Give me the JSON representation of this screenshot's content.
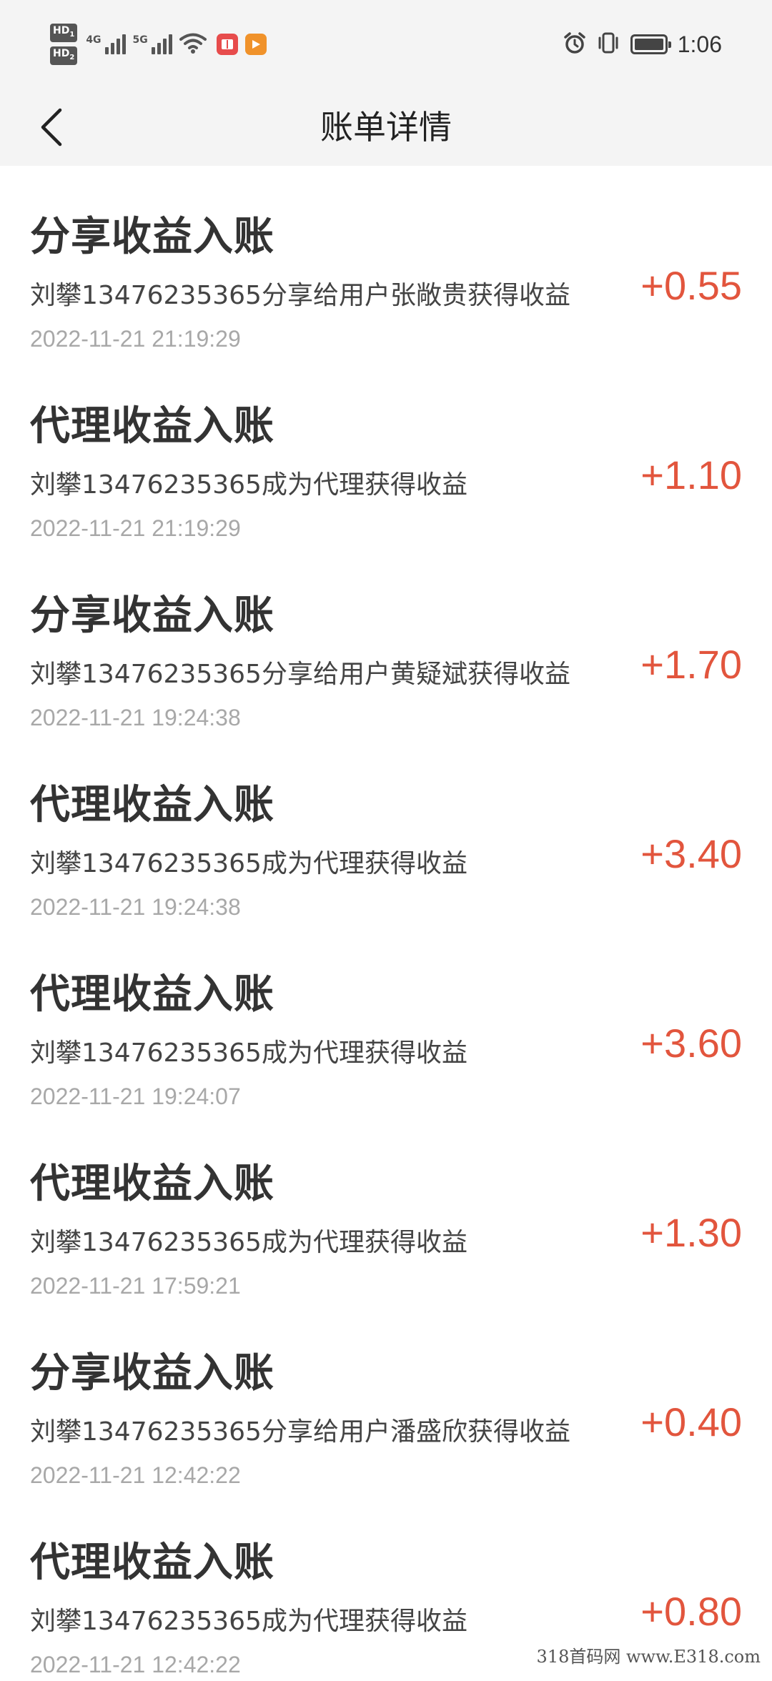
{
  "status_bar": {
    "hd1": "HD",
    "hd1_sub": "1",
    "hd2": "HD",
    "hd2_sub": "2",
    "sig1_label": "4G",
    "sig2_label": "5G",
    "time": "1:06",
    "icons": [
      "signal-icon",
      "wifi-icon",
      "app-notification-icon",
      "video-app-icon",
      "alarm-icon",
      "vibrate-icon",
      "battery-icon"
    ]
  },
  "header": {
    "title": "账单详情",
    "back_icon": "chevron-left-icon"
  },
  "colors": {
    "amount": "#e2553d",
    "header_bg": "#f4f4f4",
    "time_text": "#a8a8a8"
  },
  "records": [
    {
      "title": "分享收益入账",
      "desc": "刘攀13476235365分享给用户张敞贵获得收益",
      "time": "2022-11-21 21:19:29",
      "amount": "+0.55"
    },
    {
      "title": "代理收益入账",
      "desc": "刘攀13476235365成为代理获得收益",
      "time": "2022-11-21 21:19:29",
      "amount": "+1.10"
    },
    {
      "title": "分享收益入账",
      "desc": "刘攀13476235365分享给用户黄疑斌获得收益",
      "time": "2022-11-21 19:24:38",
      "amount": "+1.70"
    },
    {
      "title": "代理收益入账",
      "desc": "刘攀13476235365成为代理获得收益",
      "time": "2022-11-21 19:24:38",
      "amount": "+3.40"
    },
    {
      "title": "代理收益入账",
      "desc": "刘攀13476235365成为代理获得收益",
      "time": "2022-11-21 19:24:07",
      "amount": "+3.60"
    },
    {
      "title": "代理收益入账",
      "desc": "刘攀13476235365成为代理获得收益",
      "time": "2022-11-21 17:59:21",
      "amount": "+1.30"
    },
    {
      "title": "分享收益入账",
      "desc": "刘攀13476235365分享给用户潘盛欣获得收益",
      "time": "2022-11-21 12:42:22",
      "amount": "+0.40"
    },
    {
      "title": "代理收益入账",
      "desc": "刘攀13476235365成为代理获得收益",
      "time": "2022-11-21 12:42:22",
      "amount": "+0.80"
    }
  ],
  "watermark": "318首码网 www.E318.com"
}
